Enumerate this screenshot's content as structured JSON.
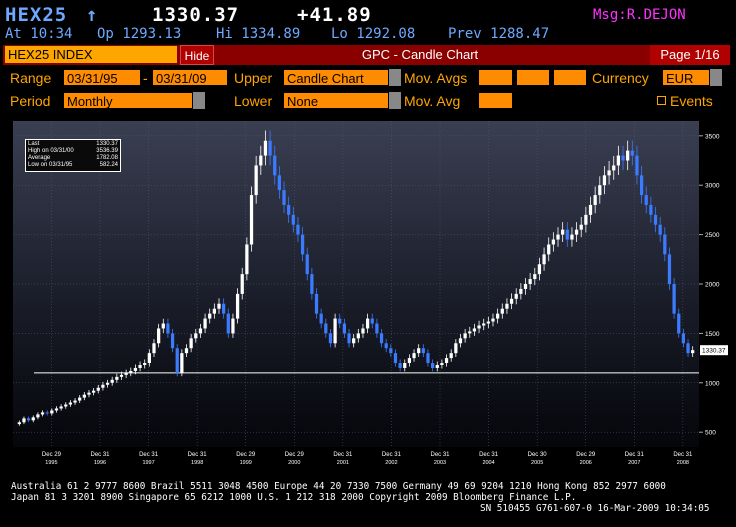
{
  "header": {
    "ticker": "HEX25",
    "arrow": "↑",
    "last": "1330.37",
    "change": "+41.89",
    "msg": "Msg:R.DEJON",
    "line2_at": "At 10:34",
    "line2_open": "Op 1293.13",
    "line2_high": "Hi 1334.89",
    "line2_low": "Lo 1292.08",
    "line2_prev": "Prev 1288.47"
  },
  "titlebar": {
    "ticker": "HEX25 INDEX",
    "hide": "Hide",
    "title": "GPC - Candle Chart",
    "page": "Page 1/16"
  },
  "controls": {
    "range_label": "Range",
    "range_start": "03/31/95",
    "range_sep": "-",
    "range_end": "03/31/09",
    "upper_label": "Upper",
    "upper_value": "Candle Chart",
    "movavgs_label": "Mov. Avgs",
    "currency_label": "Currency",
    "currency_value": "EUR",
    "period_label": "Period",
    "period_value": "Monthly",
    "lower_label": "Lower",
    "lower_value": "None",
    "movavg_label": "Mov. Avg",
    "events_label": "Events"
  },
  "legend": [
    {
      "label": "Last",
      "value": "1330.37"
    },
    {
      "label": "High on 03/31/00",
      "value": "3536.39"
    },
    {
      "label": "Average",
      "value": "1782.08"
    },
    {
      "label": "Low on 03/31/95",
      "value": "582.24"
    }
  ],
  "chart_data": {
    "type": "candlestick",
    "title": "",
    "y_ticks": [
      500,
      1000,
      1500,
      2000,
      2500,
      3000,
      3500
    ],
    "ylim": [
      350,
      3650
    ],
    "x_ticks": [
      {
        "top": "Dec 29",
        "bottom": "1995"
      },
      {
        "top": "Dec 31",
        "bottom": "1996"
      },
      {
        "top": "Dec 31",
        "bottom": "1997"
      },
      {
        "top": "Dec 31",
        "bottom": "1998"
      },
      {
        "top": "Dec 29",
        "bottom": "1999"
      },
      {
        "top": "Dec 29",
        "bottom": "2000"
      },
      {
        "top": "Dec 31",
        "bottom": "2001"
      },
      {
        "top": "Dec 31",
        "bottom": "2002"
      },
      {
        "top": "Dec 31",
        "bottom": "2003"
      },
      {
        "top": "Dec 31",
        "bottom": "2004"
      },
      {
        "top": "Dec 30",
        "bottom": "2005"
      },
      {
        "top": "Dec 29",
        "bottom": "2006"
      },
      {
        "top": "Dec 31",
        "bottom": "2007"
      },
      {
        "top": "Dec 31",
        "bottom": "2008"
      }
    ],
    "last_value_label": "1330.37",
    "reference_line_value": 1100,
    "x_start_year": 1995.25,
    "x_end_year": 2009.25,
    "series_close": [
      600,
      640,
      620,
      650,
      680,
      700,
      690,
      720,
      740,
      760,
      780,
      800,
      820,
      850,
      880,
      900,
      920,
      950,
      980,
      1000,
      1030,
      1060,
      1080,
      1100,
      1120,
      1150,
      1180,
      1200,
      1300,
      1400,
      1550,
      1600,
      1500,
      1350,
      1100,
      1300,
      1350,
      1450,
      1500,
      1550,
      1650,
      1700,
      1750,
      1800,
      1700,
      1500,
      1650,
      1900,
      2100,
      2400,
      2900,
      3200,
      3300,
      3450,
      3300,
      3100,
      2950,
      2800,
      2700,
      2600,
      2500,
      2300,
      2100,
      1900,
      1700,
      1600,
      1500,
      1400,
      1650,
      1600,
      1500,
      1400,
      1450,
      1500,
      1550,
      1650,
      1600,
      1500,
      1400,
      1350,
      1300,
      1200,
      1150,
      1200,
      1250,
      1300,
      1350,
      1300,
      1200,
      1150,
      1180,
      1200,
      1250,
      1300,
      1400,
      1450,
      1500,
      1520,
      1550,
      1580,
      1600,
      1620,
      1650,
      1700,
      1750,
      1800,
      1850,
      1900,
      1950,
      2000,
      2050,
      2100,
      2200,
      2300,
      2400,
      2450,
      2500,
      2550,
      2450,
      2500,
      2550,
      2600,
      2700,
      2800,
      2900,
      3000,
      3100,
      3150,
      3200,
      3300,
      3250,
      3350,
      3300,
      3100,
      2900,
      2800,
      2700,
      2600,
      2500,
      2300,
      2000,
      1700,
      1500,
      1400,
      1300,
      1330
    ]
  },
  "footer": {
    "line1": "Australia 61 2 9777 8600 Brazil 5511 3048 4500 Europe 44 20 7330 7500 Germany 49 69 9204 1210 Hong Kong 852 2977 6000",
    "line2": "Japan 81 3 3201 8900         Singapore 65 6212 1000       U.S. 1 212 318 2000          Copyright 2009 Bloomberg Finance L.P.",
    "line3": "SN 510455 G761-607-0 16-Mar-2009 10:34:05"
  },
  "colors": {
    "orange": "#ffa500",
    "field": "#ff8c00",
    "blue_text": "#6ea8ff",
    "title_bar": "#8a0000",
    "msg": "#ff33ff",
    "up_candle": "#ffffff",
    "down_candle": "#3a7bff"
  }
}
